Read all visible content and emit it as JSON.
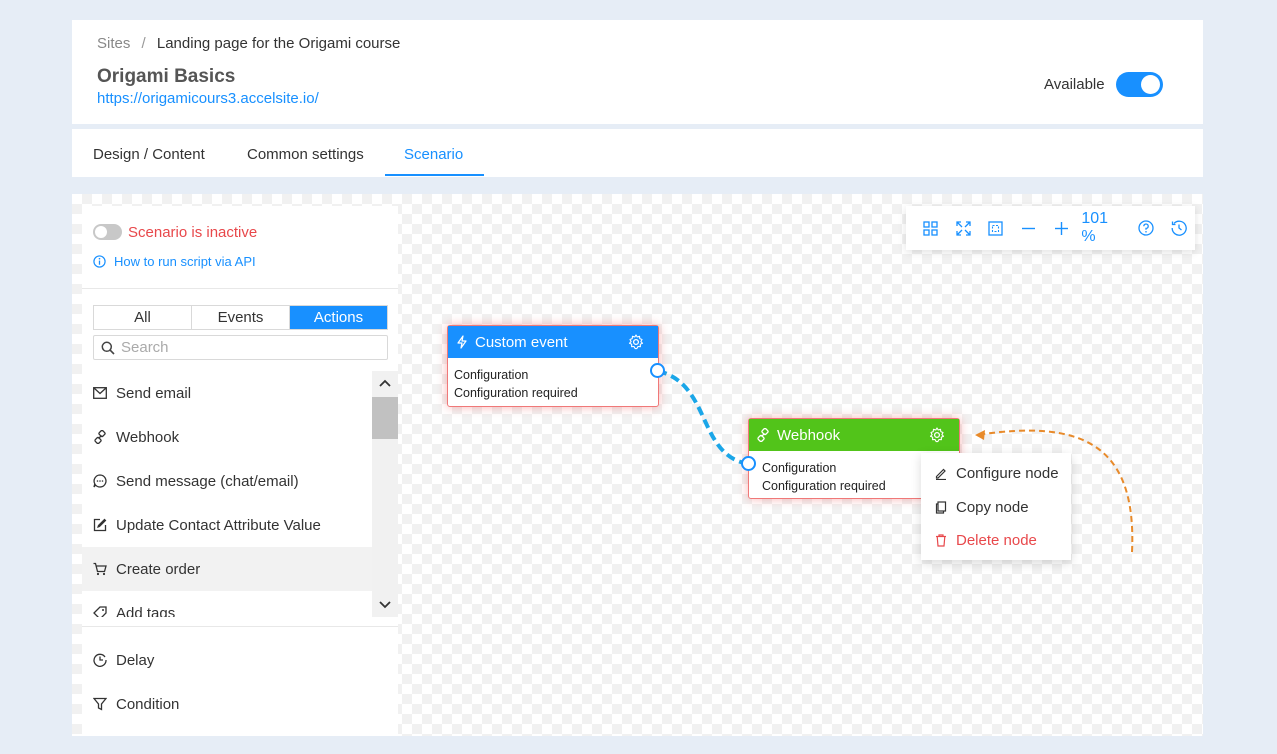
{
  "header": {
    "breadcrumb": {
      "root": "Sites",
      "separator": "/",
      "current": "Landing page for the Origami course"
    },
    "site_title": "Origami Basics",
    "site_url": "https://origamicours3.accelsite.io/",
    "available_label": "Available",
    "available_on": true
  },
  "tabs": [
    {
      "label": "Design / Content",
      "active": false
    },
    {
      "label": "Common settings",
      "active": false
    },
    {
      "label": "Scenario",
      "active": true
    }
  ],
  "panel": {
    "scenario_status": "Scenario is inactive",
    "scenario_active": false,
    "api_link": "How to run script via API",
    "filters": [
      {
        "label": "All",
        "active": false
      },
      {
        "label": "Events",
        "active": false
      },
      {
        "label": "Actions",
        "active": true
      }
    ],
    "search_placeholder": "Search",
    "actions": [
      {
        "label": "Send email",
        "icon": "mail-icon"
      },
      {
        "label": "Webhook",
        "icon": "link-icon"
      },
      {
        "label": "Send message (chat/email)",
        "icon": "chat-icon"
      },
      {
        "label": "Update Contact Attribute Value",
        "icon": "edit-icon"
      },
      {
        "label": "Create order",
        "icon": "cart-icon"
      },
      {
        "label": "Add tags",
        "icon": "tag-icon"
      }
    ],
    "bottom_items": [
      {
        "label": "Delay",
        "icon": "clock-icon"
      },
      {
        "label": "Condition",
        "icon": "filter-icon"
      }
    ]
  },
  "toolbar": {
    "zoom": "101 %",
    "buttons": [
      "grid-icon",
      "fullscreen-icon",
      "fit-icon",
      "zoom-out-icon",
      "zoom-in-icon",
      "help-icon",
      "history-icon"
    ]
  },
  "nodes": {
    "custom_event": {
      "title": "Custom event",
      "config_label": "Configuration",
      "config_status": "Configuration required"
    },
    "webhook": {
      "title": "Webhook",
      "config_label": "Configuration",
      "config_status": "Configuration required"
    }
  },
  "context_menu": {
    "configure": "Configure node",
    "copy": "Copy node",
    "delete": "Delete node"
  },
  "colors": {
    "accent": "#1890ff",
    "event_node": "#1890ff",
    "action_node": "#52c41a",
    "danger": "#e8484b",
    "connector": "#1aa6e8",
    "annotation_arrow": "#e88a2a"
  }
}
